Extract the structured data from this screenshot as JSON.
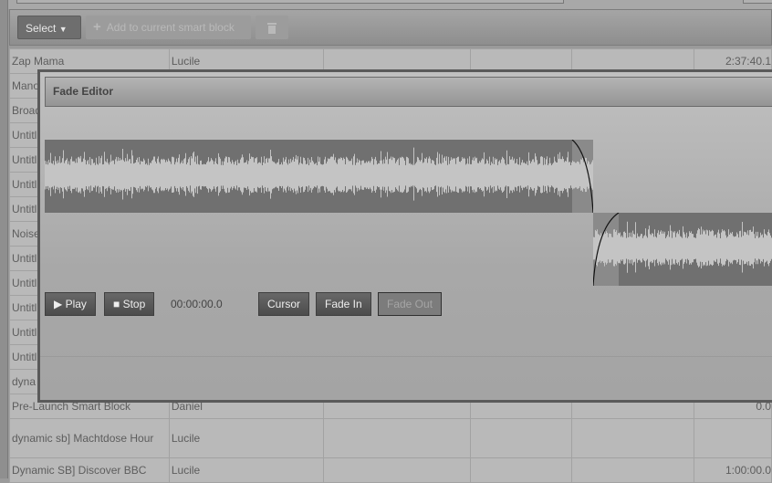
{
  "toolbar": {
    "select_label": "Select",
    "add_label": "Add to current smart block",
    "delete_icon": "trash-icon"
  },
  "table": {
    "rows": [
      [
        "Zap Mama",
        "Lucile",
        "",
        "",
        "",
        "2:37:40.1"
      ],
      [
        "Mano",
        "",
        "",
        "",
        "",
        ""
      ],
      [
        "Broad",
        "",
        "",
        "",
        "",
        ""
      ],
      [
        "Untitl",
        "",
        "",
        "",
        "",
        ""
      ],
      [
        "Untitl",
        "",
        "",
        "",
        "",
        ""
      ],
      [
        "Untitl",
        "",
        "",
        "",
        "",
        ""
      ],
      [
        "Untitl",
        "",
        "",
        "",
        "",
        ""
      ],
      [
        "Noise",
        "",
        "",
        "",
        "",
        ""
      ],
      [
        "Untitl",
        "",
        "",
        "",
        "",
        ""
      ],
      [
        "Untitl",
        "",
        "",
        "",
        "",
        ""
      ],
      [
        "Untitl",
        "",
        "",
        "",
        "",
        ""
      ],
      [
        "Untitl",
        "",
        "",
        "",
        "",
        ""
      ],
      [
        "Untitl",
        "",
        "",
        "",
        "",
        ""
      ],
      [
        "dyna",
        "",
        "",
        "",
        "",
        ""
      ],
      [
        "Pre-Launch Smart Block",
        "Daniel",
        "",
        "",
        "",
        "0.0"
      ],
      [
        "dynamic sb] Machtdose Hour",
        "Lucile",
        "",
        "",
        "",
        ""
      ],
      [
        "Dynamic SB] Discover BBC",
        "Lucile",
        "",
        "",
        "",
        "1:00:00.0"
      ]
    ]
  },
  "modal": {
    "title": "Fade Editor",
    "play_label": "Play",
    "stop_label": "Stop",
    "time": "00:00:00.0",
    "cursor_label": "Cursor",
    "fade_in_label": "Fade In",
    "fade_out_label": "Fade Out",
    "active_mode": "Fade Out"
  },
  "colors": {
    "wave_bg": "#707070",
    "wave_fg": "#c4c4c4",
    "fade_region": "#8a8a8a"
  }
}
